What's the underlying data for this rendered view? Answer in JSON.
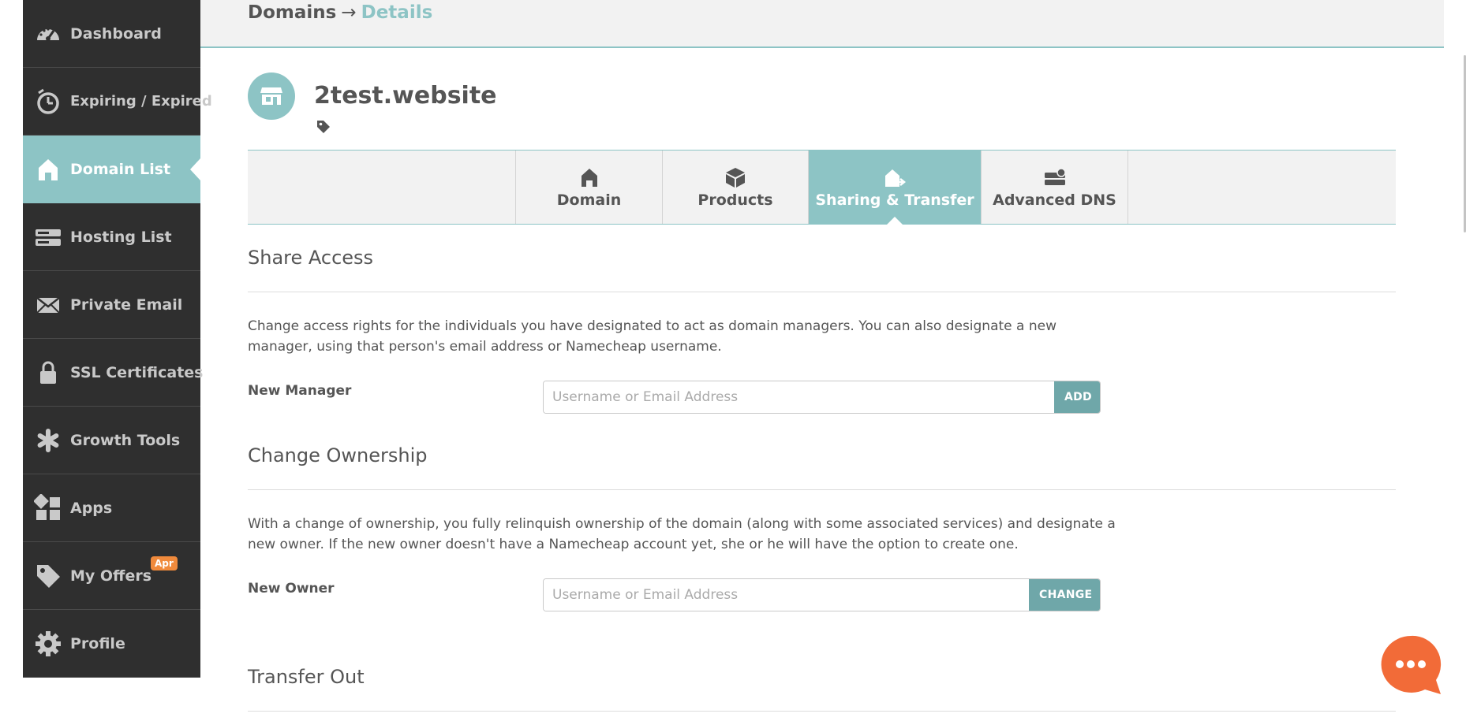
{
  "sidebar": {
    "items": [
      {
        "label": "Dashboard",
        "icon": "speedometer-icon"
      },
      {
        "label": "Expiring / Expired",
        "icon": "timer-icon"
      },
      {
        "label": "Domain List",
        "icon": "house-icon",
        "active": true
      },
      {
        "label": "Hosting List",
        "icon": "server-icon"
      },
      {
        "label": "Private Email",
        "icon": "envelope-icon"
      },
      {
        "label": "SSL Certificates",
        "icon": "lock-icon"
      },
      {
        "label": "Growth Tools",
        "icon": "asterisk-icon"
      },
      {
        "label": "Apps",
        "icon": "apps-grid-icon"
      },
      {
        "label": "My Offers",
        "icon": "tag-icon",
        "badge": "Apr"
      },
      {
        "label": "Profile",
        "icon": "gear-icon"
      }
    ]
  },
  "breadcrumb": {
    "parent": "Domains",
    "separator": "→",
    "current": "Details"
  },
  "domain": {
    "name": "2test.website",
    "icon": "storefront-icon",
    "tag_icon": "tag-icon"
  },
  "tabs": [
    {
      "label": "Domain",
      "icon": "house-icon"
    },
    {
      "label": "Products",
      "icon": "box-icon"
    },
    {
      "label": "Sharing & Transfer",
      "icon": "house-arrow-icon",
      "active": true
    },
    {
      "label": "Advanced DNS",
      "icon": "dns-server-icon"
    }
  ],
  "share_access": {
    "title": "Share Access",
    "description": "Change access rights for the individuals you have designated to act as domain managers. You can also designate a new manager, using that person's email address or Namecheap username.",
    "field_label": "New Manager",
    "placeholder": "Username or Email Address",
    "button": "ADD"
  },
  "change_ownership": {
    "title": "Change Ownership",
    "description": "With a change of ownership, you fully relinquish ownership of the domain (along with some associated services) and designate a new owner. If the new owner doesn't have a Namecheap account yet, she or he will have the option to create one.",
    "field_label": "New Owner",
    "placeholder": "Username or Email Address",
    "button": "CHANGE"
  },
  "transfer_out": {
    "title": "Transfer Out"
  },
  "colors": {
    "accent": "#8dc4c5",
    "button": "#6fa7a9",
    "sidebar_bg": "#2f2f2f",
    "badge": "#f08a3c",
    "chat": "#f26b38"
  }
}
